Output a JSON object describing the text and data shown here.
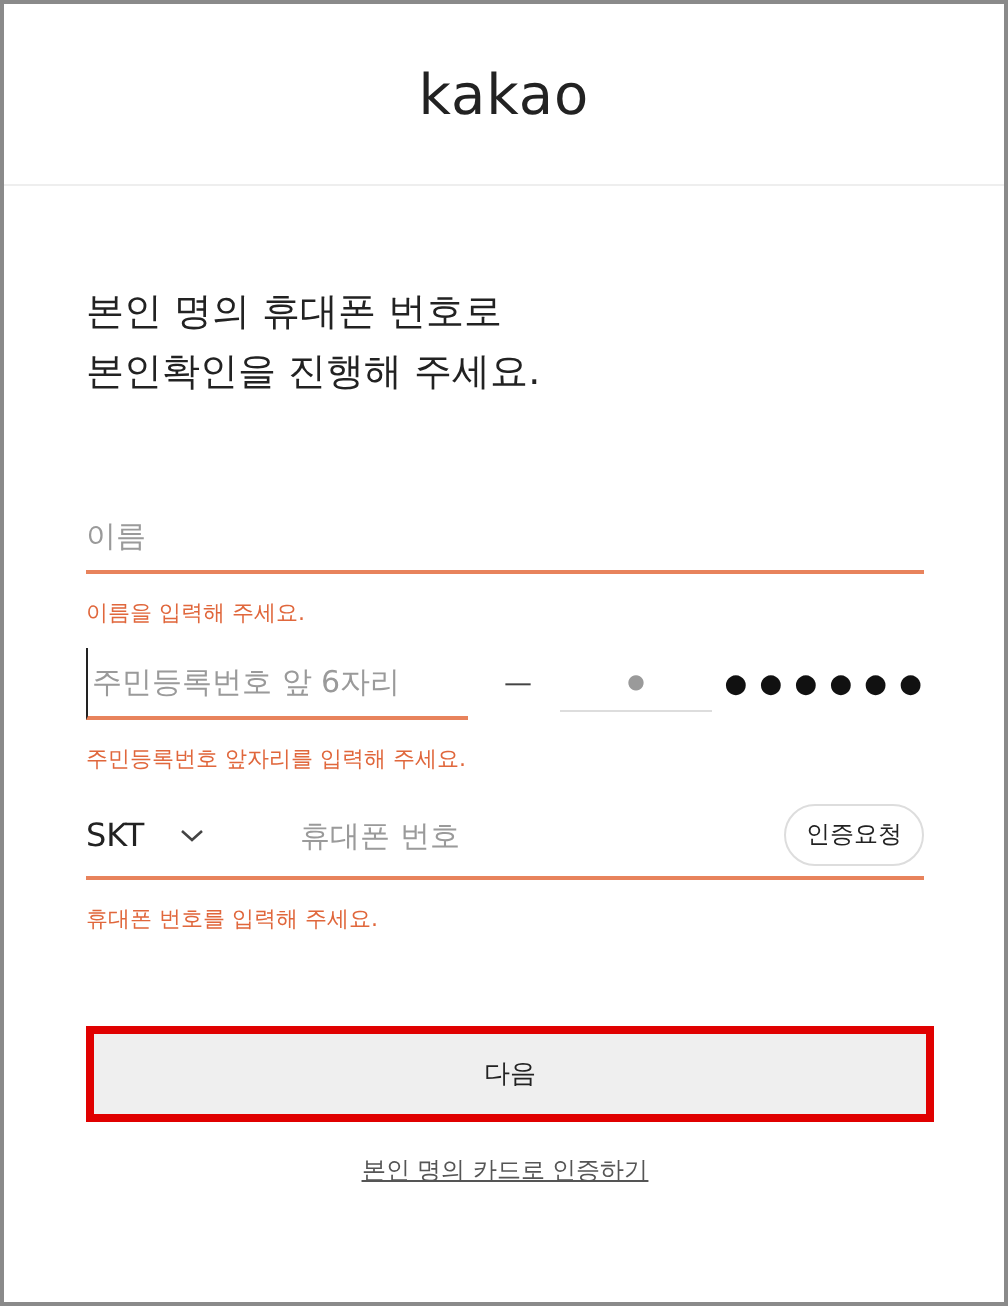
{
  "header": {
    "logo": "kakao"
  },
  "title_lines": [
    "본인 명의 휴대폰 번호로",
    "본인확인을 진행해 주세요."
  ],
  "name_field": {
    "placeholder": "이름",
    "invalid": true,
    "error": "이름을 입력해 주세요."
  },
  "rrn": {
    "front": {
      "placeholder": "주민등록번호 앞 6자리",
      "invalid": true,
      "focused": true
    },
    "separator": "—",
    "back": {
      "placeholder": "●",
      "invalid": false
    },
    "masked": "● ● ● ● ● ●",
    "error": "주민등록번호 앞자리를 입력해 주세요."
  },
  "phone": {
    "carrier": "SKT",
    "placeholder": "휴대폰 번호",
    "request_button": "인증요청",
    "invalid": true,
    "error": "휴대폰 번호를 입력해 주세요."
  },
  "next_button": {
    "label": "다음",
    "highlighted": true
  },
  "card_link": "본인 명의 카드로 인증하기"
}
